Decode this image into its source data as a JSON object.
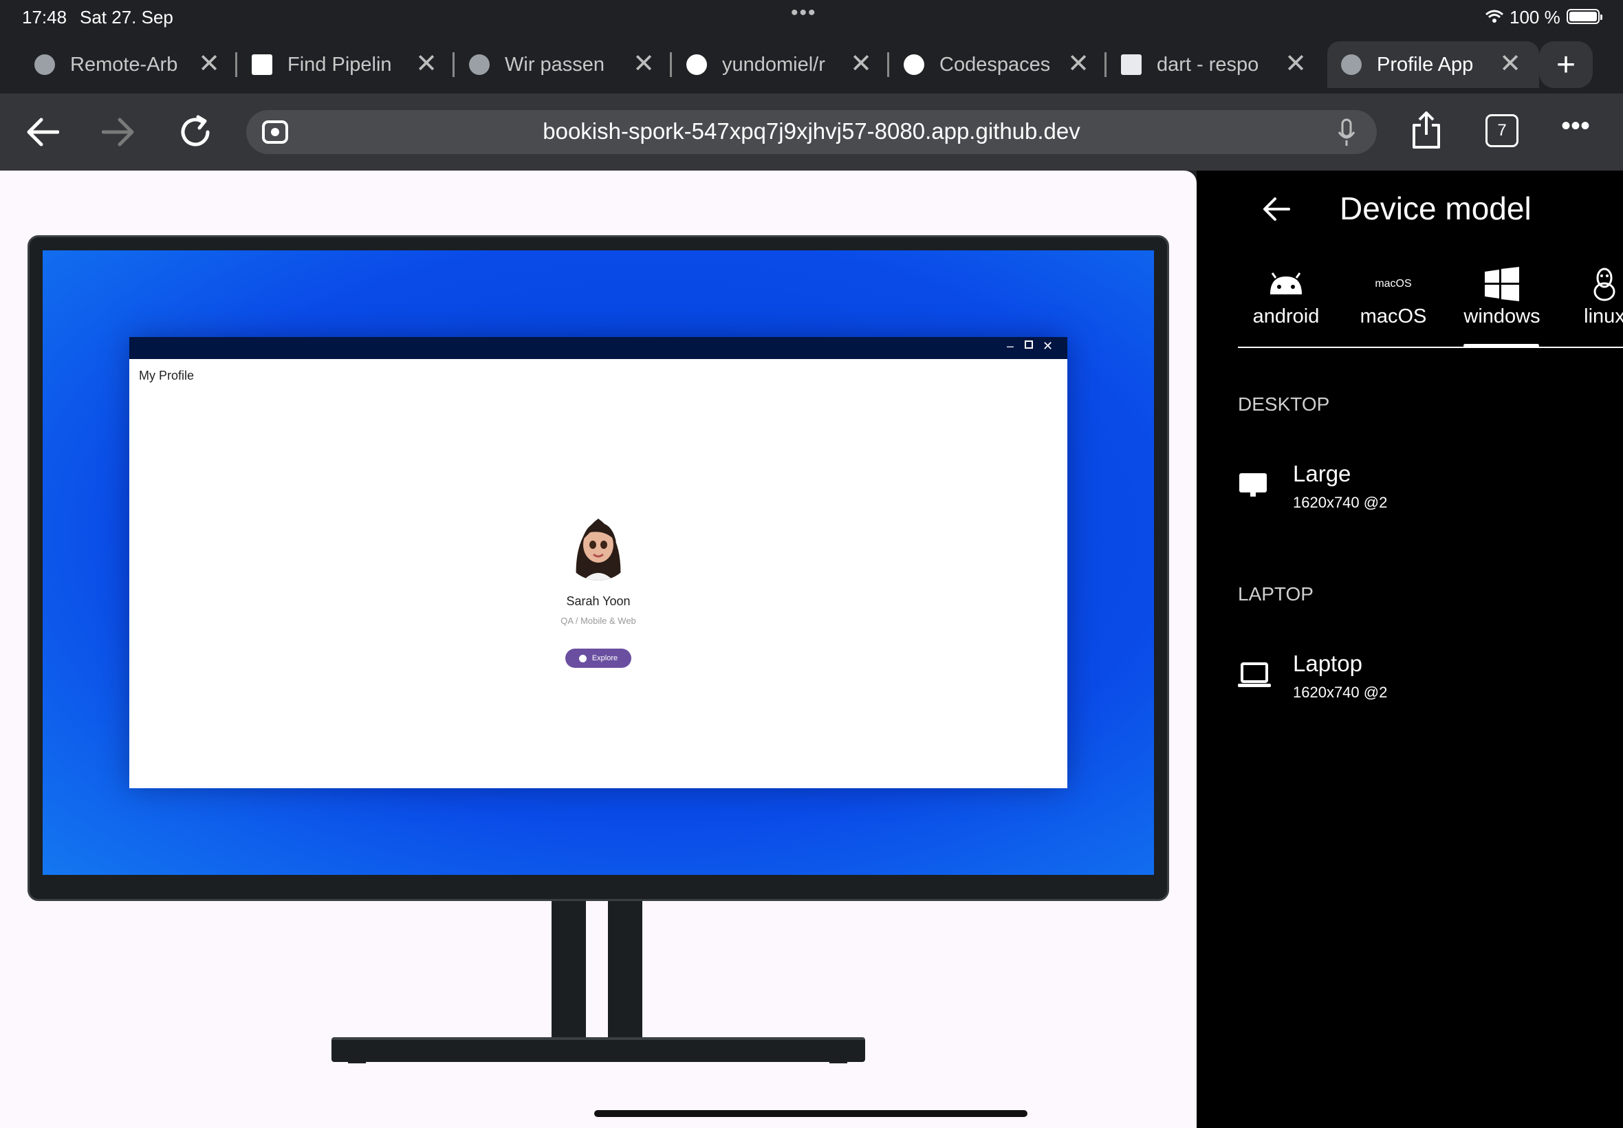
{
  "status_bar": {
    "time": "17:48",
    "date": "Sat 27. Sep",
    "battery": "100 %"
  },
  "tabs": [
    {
      "label": "Remote-Arb",
      "icon": "globe-icon"
    },
    {
      "label": "Find Pipelin",
      "icon": "site-favicon"
    },
    {
      "label": "Wir passen",
      "icon": "globe-icon"
    },
    {
      "label": "yundomiel/r",
      "icon": "github-icon"
    },
    {
      "label": "Codespaces",
      "icon": "github-icon"
    },
    {
      "label": "dart - respo",
      "icon": "site-favicon"
    },
    {
      "label": "Profile App",
      "icon": "globe-icon",
      "active": true
    }
  ],
  "toolbar": {
    "url": "bookish-spork-547xpq7j9xjhvj57-8080.app.github.dev",
    "tab_count": "7"
  },
  "app": {
    "window_title": "My Profile",
    "name": "Sarah Yoon",
    "role": "QA / Mobile & Web",
    "button_label": "Explore"
  },
  "panel": {
    "title": "Device model",
    "platforms": [
      {
        "label": "android",
        "icon": "android-icon"
      },
      {
        "label": "macOS",
        "icon": "macos-icon",
        "icon_text": "macOS"
      },
      {
        "label": "windows",
        "icon": "windows-icon",
        "selected": true
      },
      {
        "label": "linux",
        "icon": "linux-icon"
      }
    ],
    "sections": [
      {
        "header": "DESKTOP",
        "devices": [
          {
            "name": "Large",
            "resolution": "1620x740 @2",
            "icon": "monitor-icon"
          }
        ]
      },
      {
        "header": "LAPTOP",
        "devices": [
          {
            "name": "Laptop",
            "resolution": "1620x740 @2",
            "icon": "laptop-icon"
          }
        ]
      }
    ]
  },
  "colors": {
    "accent": "#6a4fa0",
    "desktop_blue": "#0a4be8",
    "titlebar": "#001542"
  }
}
